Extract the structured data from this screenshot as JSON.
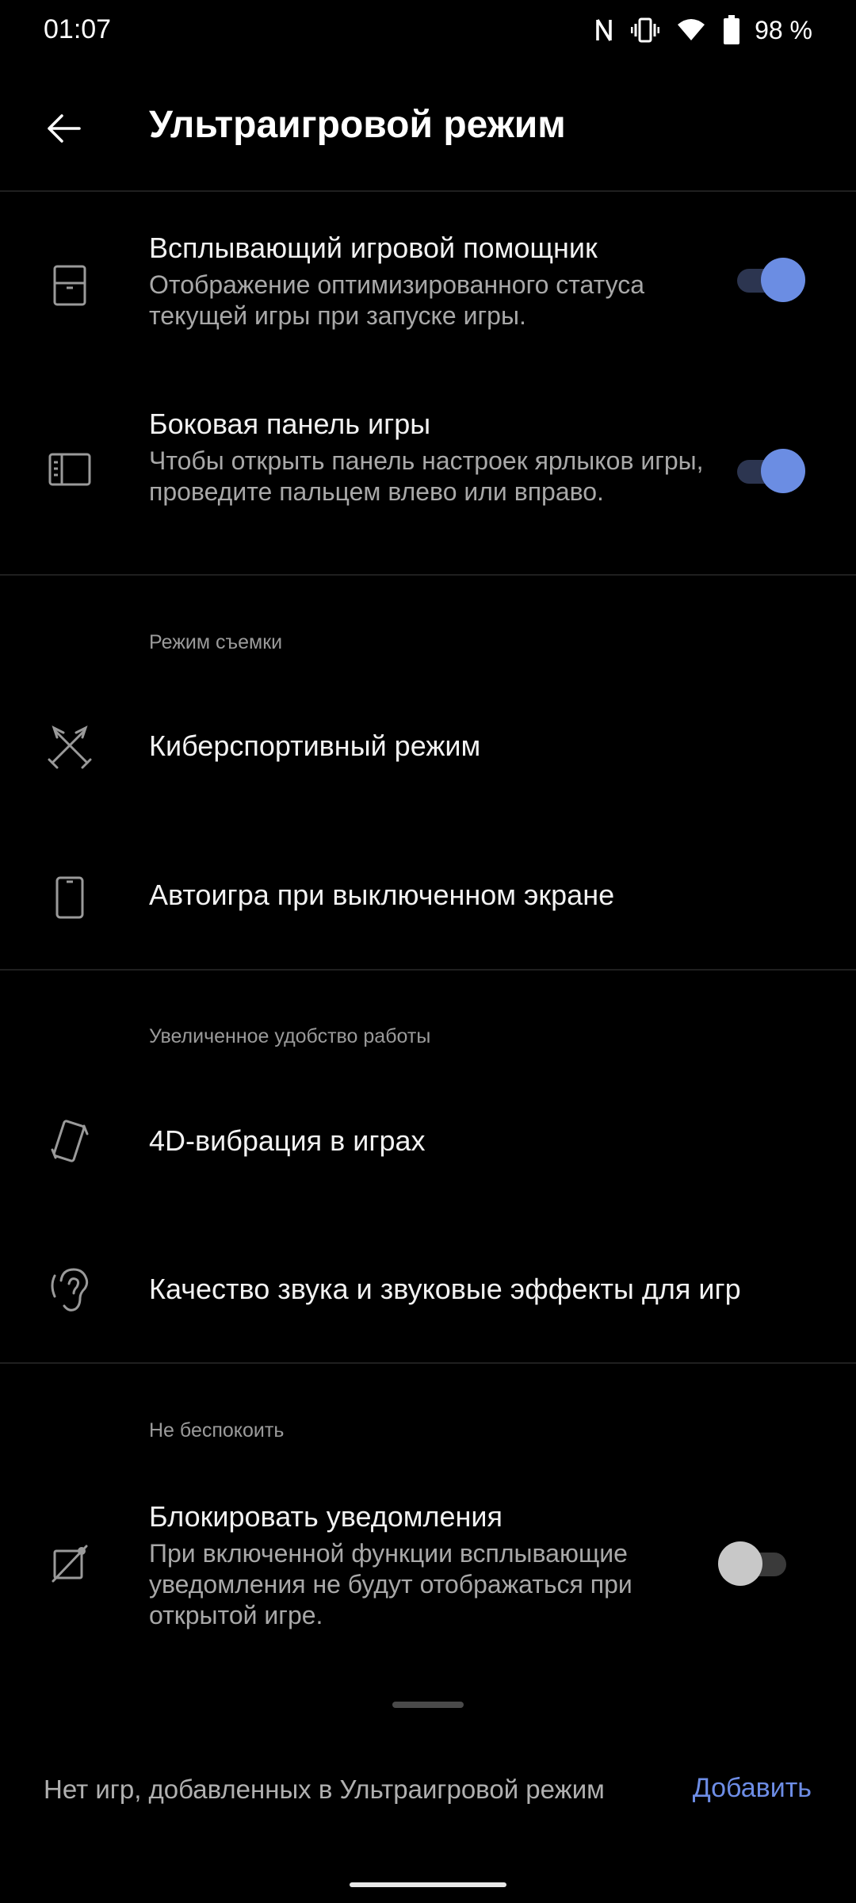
{
  "status_bar": {
    "time": "01:07",
    "battery_text": "98 %",
    "icons": [
      "nfc-icon",
      "vibrate-icon",
      "wifi-icon",
      "battery-icon"
    ]
  },
  "app_bar": {
    "title": "Ультраигровой режим",
    "back_icon": "arrow-left-icon"
  },
  "settings": {
    "game_assistant": {
      "title": "Всплывающий игровой помощник",
      "subtitle": "Отображение оптимизированного статуса текущей игры при запуске игры.",
      "enabled": true,
      "icon": "panel-icon"
    },
    "game_sidebar": {
      "title": "Боковая панель игры",
      "subtitle": "Чтобы открыть панель настроек ярлыков игры, проведите пальцем влево или вправо.",
      "enabled": true,
      "icon": "sidebar-icon"
    }
  },
  "section_capture": {
    "header": "Режим съемки",
    "items": [
      {
        "title": "Киберспортивный режим",
        "icon": "crossed-swords-icon"
      },
      {
        "title": "Автоигра при выключенном экране",
        "icon": "phone-icon"
      }
    ]
  },
  "section_experience": {
    "header": "Увеличенное удобство работы",
    "items": [
      {
        "title": "4D-вибрация в играх",
        "icon": "vibration-phone-icon"
      },
      {
        "title": "Качество звука и звуковые эффекты для игр",
        "icon": "ear-icon"
      }
    ]
  },
  "section_dnd": {
    "header": "Не беспокоить",
    "block_notifications": {
      "title": "Блокировать уведомления",
      "subtitle": "При включенной функции всплывающие уведомления не будут отображаться при открытой игре.",
      "enabled": false,
      "icon": "notifications-off-icon"
    }
  },
  "footer": {
    "text": "Нет игр, добавленных в Ультраигровой режим",
    "add_label": "Добавить"
  },
  "colors": {
    "background": "#000000",
    "accent": "#6d8de6",
    "toggle_on_thumb": "#6b8de3",
    "toggle_on_track": "#2c3550"
  }
}
